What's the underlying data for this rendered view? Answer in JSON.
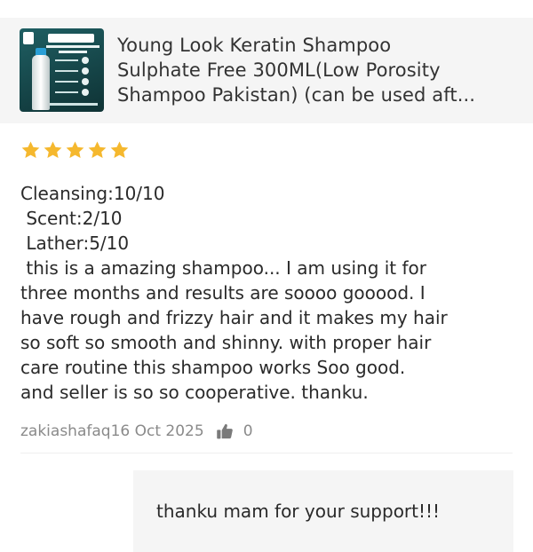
{
  "product": {
    "image_alt": "Young Look Keratin Sulphate Free Shampoo bottle",
    "image_brand": "YOUNG LOOK",
    "title_lines": [
      "Young Look Keratin Shampoo",
      "Sulphate Free 300ML(Low Porosity",
      "Shampoo Pakistan) (can be used aft..."
    ]
  },
  "review": {
    "rating": 5,
    "rating_max": 5,
    "star_color": "#f5b82e",
    "text_lines": [
      "Cleansing:10/10",
      " Scent:2/10",
      " Lather:5/10",
      " this is a amazing shampoo... I am using it for",
      "three months and results are soooo gooood. I",
      "have rough and frizzy hair and it makes my hair",
      "so soft so smooth and shinny. with proper hair",
      "care routine this shampoo works Soo good.",
      "and seller is so so cooperative. thanku."
    ],
    "author": "zakiashafaq",
    "date": "16 Oct 2025",
    "like_icon": "thumbs-up-icon",
    "like_count": "0"
  },
  "seller_reply": {
    "text": "thanku mam for your support!!!"
  }
}
